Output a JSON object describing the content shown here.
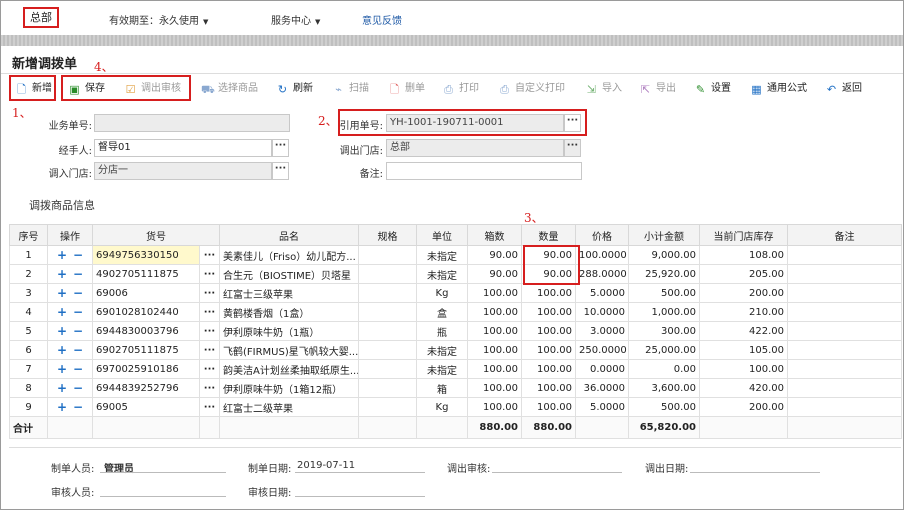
{
  "topbar": {
    "org": "总部",
    "validity": "有效期至：永久使用",
    "service": "服务中心",
    "feedback": "意见反馈"
  },
  "page": {
    "title": "新增调拨单"
  },
  "toolbar": {
    "new": "新增",
    "save": "保存",
    "approve": "调出审核",
    "select_goods": "选择商品",
    "refresh": "刷新",
    "scan": "扫描",
    "delete_doc": "删单",
    "print": "打印",
    "custom_print": "自定义打印",
    "import": "导入",
    "export": "导出",
    "settings": "设置",
    "formula": "通用公式",
    "back": "返回"
  },
  "annotations": {
    "a1": "1、",
    "a2": "2、",
    "a3": "3、",
    "a4": "4、"
  },
  "form": {
    "doc_no_label": "业务单号:",
    "doc_no_value": "",
    "handler_label": "经手人:",
    "handler_value": "督导01",
    "in_store_label": "调入门店:",
    "in_store_value": "分店一",
    "ref_no_label": "引用单号:",
    "ref_no_value": "YH-1001-190711-0001",
    "out_store_label": "调出门店:",
    "out_store_value": "总部",
    "remark_label": "备注:",
    "remark_value": "",
    "btn": "···"
  },
  "section": {
    "title": "调拨商品信息"
  },
  "table": {
    "headers": [
      "序号",
      "操作",
      "货号",
      "品名",
      "规格",
      "单位",
      "箱数",
      "数量",
      "价格",
      "小计金额",
      "当前门店库存",
      "备注"
    ],
    "rows": [
      {
        "no": "1",
        "code": "6949756330150",
        "name": "美素佳儿（Friso）幼儿配方...",
        "spec": "",
        "unit": "未指定",
        "boxes": "90.00",
        "qty": "90.00",
        "price": "100.0000",
        "subtotal": "9,000.00",
        "stock": "108.00",
        "remark": ""
      },
      {
        "no": "2",
        "code": "4902705111875",
        "name": "合生元（BIOSTIME）贝塔星",
        "spec": "",
        "unit": "未指定",
        "boxes": "90.00",
        "qty": "90.00",
        "price": "288.0000",
        "subtotal": "25,920.00",
        "stock": "205.00",
        "remark": ""
      },
      {
        "no": "3",
        "code": "69006",
        "name": "红富士三级苹果",
        "spec": "",
        "unit": "Kg",
        "boxes": "100.00",
        "qty": "100.00",
        "price": "5.0000",
        "subtotal": "500.00",
        "stock": "200.00",
        "remark": ""
      },
      {
        "no": "4",
        "code": "6901028102440",
        "name": "黄鹤楼香烟（1盒）",
        "spec": "",
        "unit": "盒",
        "boxes": "100.00",
        "qty": "100.00",
        "price": "10.0000",
        "subtotal": "1,000.00",
        "stock": "210.00",
        "remark": ""
      },
      {
        "no": "5",
        "code": "6944830003796",
        "name": "伊利原味牛奶（1瓶）",
        "spec": "",
        "unit": "瓶",
        "boxes": "100.00",
        "qty": "100.00",
        "price": "3.0000",
        "subtotal": "300.00",
        "stock": "422.00",
        "remark": ""
      },
      {
        "no": "6",
        "code": "6902705111875",
        "name": "飞鹤(FIRMUS)星飞帆较大婴...",
        "spec": "",
        "unit": "未指定",
        "boxes": "100.00",
        "qty": "100.00",
        "price": "250.0000",
        "subtotal": "25,000.00",
        "stock": "105.00",
        "remark": ""
      },
      {
        "no": "7",
        "code": "6970025910186",
        "name": "韵美洁A计划丝柔抽取纸原生...",
        "spec": "",
        "unit": "未指定",
        "boxes": "100.00",
        "qty": "100.00",
        "price": "0.0000",
        "subtotal": "0.00",
        "stock": "100.00",
        "remark": ""
      },
      {
        "no": "8",
        "code": "6944839252796",
        "name": "伊利原味牛奶（1箱12瓶）",
        "spec": "",
        "unit": "箱",
        "boxes": "100.00",
        "qty": "100.00",
        "price": "36.0000",
        "subtotal": "3,600.00",
        "stock": "420.00",
        "remark": ""
      },
      {
        "no": "9",
        "code": "69005",
        "name": "红富士二级苹果",
        "spec": "",
        "unit": "Kg",
        "boxes": "100.00",
        "qty": "100.00",
        "price": "5.0000",
        "subtotal": "500.00",
        "stock": "200.00",
        "remark": ""
      }
    ],
    "total_label": "合计",
    "total_boxes": "880.00",
    "total_qty": "880.00",
    "total_amount": "65,820.00",
    "ops_add": "+",
    "ops_del": "−",
    "dots": "···"
  },
  "footer": {
    "creator_label": "制单人员:",
    "creator_value": "管理员",
    "created_date_label": "制单日期:",
    "created_date_value": "2019-07-11",
    "out_audit_label": "调出审核:",
    "out_date_label": "调出日期:",
    "auditor_label": "审核人员:",
    "audit_date_label": "审核日期:"
  }
}
